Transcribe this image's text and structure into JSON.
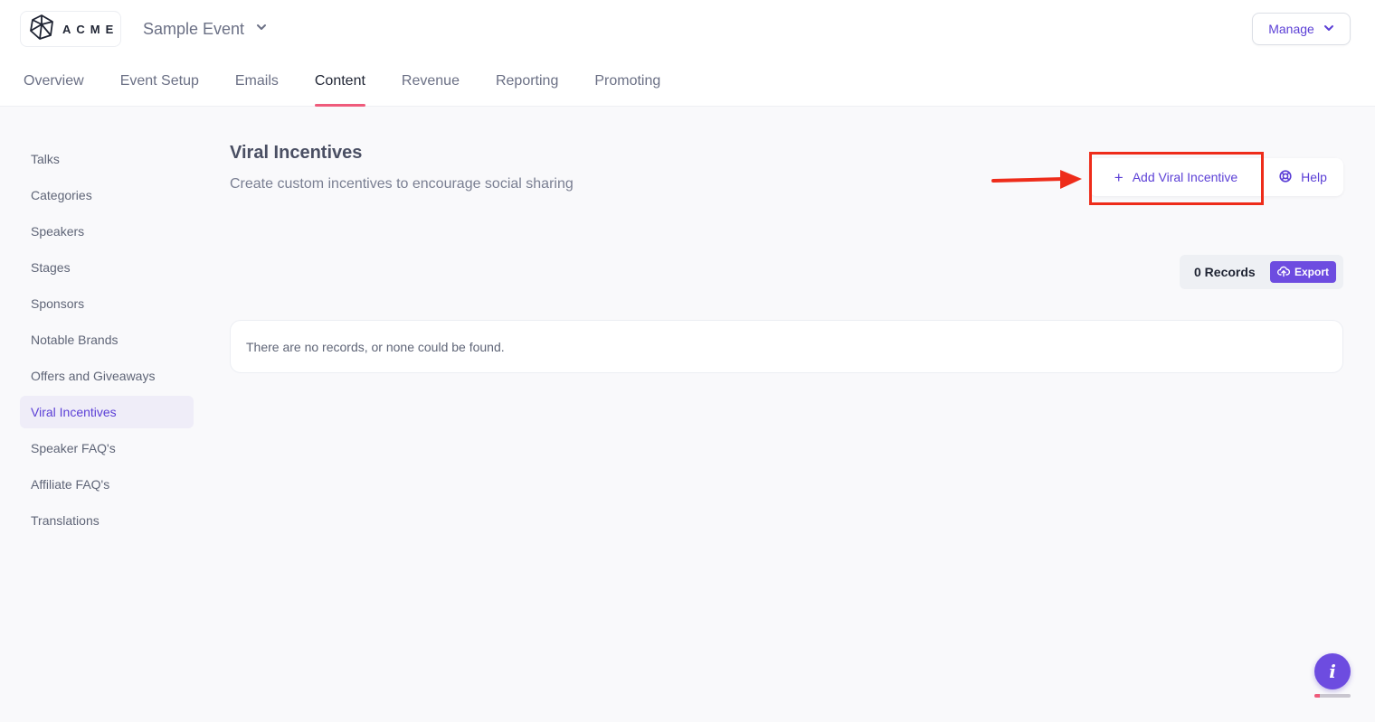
{
  "brand": {
    "logo_text": "ACME",
    "logo_icon": "polyhedron-logo-icon"
  },
  "event_switcher": {
    "name": "Sample Event",
    "icon": "chevron-down-icon"
  },
  "manage": {
    "label": "Manage",
    "icon": "chevron-down-icon"
  },
  "tabs": [
    {
      "label": "Overview",
      "active": false
    },
    {
      "label": "Event Setup",
      "active": false
    },
    {
      "label": "Emails",
      "active": false
    },
    {
      "label": "Content",
      "active": true
    },
    {
      "label": "Revenue",
      "active": false
    },
    {
      "label": "Reporting",
      "active": false
    },
    {
      "label": "Promoting",
      "active": false
    }
  ],
  "sidebar": {
    "items": [
      {
        "label": "Talks",
        "active": false
      },
      {
        "label": "Categories",
        "active": false
      },
      {
        "label": "Speakers",
        "active": false
      },
      {
        "label": "Stages",
        "active": false
      },
      {
        "label": "Sponsors",
        "active": false
      },
      {
        "label": "Notable Brands",
        "active": false
      },
      {
        "label": "Offers and Giveaways",
        "active": false
      },
      {
        "label": "Viral Incentives",
        "active": true
      },
      {
        "label": "Speaker FAQ's",
        "active": false
      },
      {
        "label": "Affiliate FAQ's",
        "active": false
      },
      {
        "label": "Translations",
        "active": false
      }
    ]
  },
  "main": {
    "title": "Viral Incentives",
    "subtitle": "Create custom incentives to encourage social sharing",
    "add_button": {
      "label": "Add Viral Incentive",
      "icon": "plus-icon"
    },
    "help_button": {
      "label": "Help",
      "icon": "lifebuoy-icon"
    },
    "records": {
      "count_label": "0 Records"
    },
    "export_button": {
      "label": "Export",
      "icon": "cloud-upload-icon"
    },
    "empty_message": "There are no records, or none could be found."
  },
  "info_fab": {
    "glyph": "i",
    "icon": "info-icon",
    "progress": 0.15
  },
  "colors": {
    "accent": "#5b3fd6",
    "accent_fill": "#6d4ce0",
    "active_tab_underline": "#ef5b7b",
    "annotation": "#ee2c1a"
  }
}
